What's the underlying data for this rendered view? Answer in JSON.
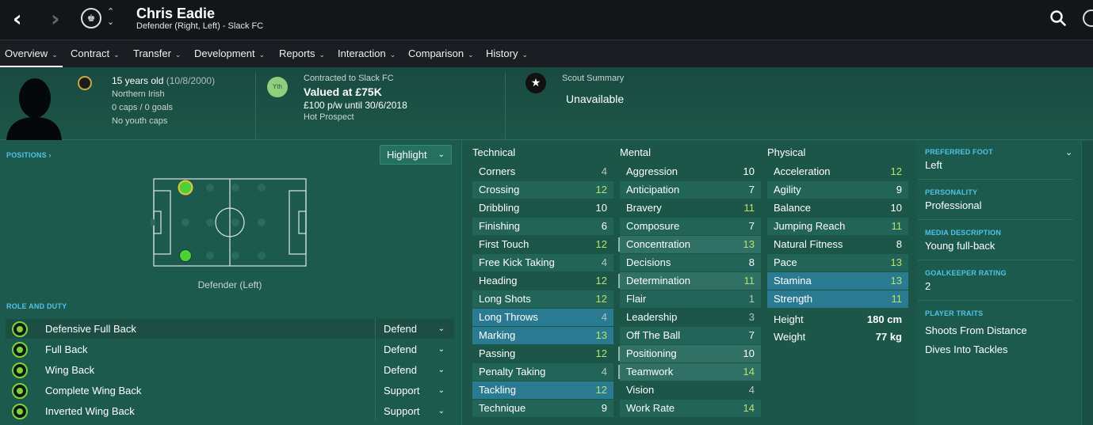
{
  "header": {
    "name": "Chris Eadie",
    "subtitle": "Defender (Right, Left) - Slack FC"
  },
  "tabs": [
    {
      "label": "Overview",
      "active": true
    },
    {
      "label": "Contract"
    },
    {
      "label": "Transfer"
    },
    {
      "label": "Development"
    },
    {
      "label": "Reports"
    },
    {
      "label": "Interaction"
    },
    {
      "label": "Comparison"
    },
    {
      "label": "History"
    }
  ],
  "info": {
    "age": "15 years old",
    "dob": "(10/8/2000)",
    "nationality": "Northern Irish",
    "caps": "0 caps / 0 goals",
    "youth_caps": "No youth caps",
    "yth_badge": "Yth",
    "contract": "Contracted to Slack FC",
    "value": "Valued at £75K",
    "wage": "£100 p/w until 30/6/2018",
    "status": "Hot Prospect",
    "scout_title": "Scout Summary",
    "scout_value": "Unavailable"
  },
  "positions": {
    "link": "POSITIONS",
    "highlight": "Highlight",
    "caption": "Defender (Left)"
  },
  "roles": {
    "title": "ROLE AND DUTY",
    "items": [
      {
        "name": "Defensive Full Back",
        "duty": "Defend"
      },
      {
        "name": "Full Back",
        "duty": "Defend"
      },
      {
        "name": "Wing Back",
        "duty": "Defend"
      },
      {
        "name": "Complete Wing Back",
        "duty": "Support"
      },
      {
        "name": "Inverted Wing Back",
        "duty": "Support"
      }
    ]
  },
  "attributes": {
    "technical_title": "Technical",
    "mental_title": "Mental",
    "physical_title": "Physical",
    "technical": [
      {
        "name": "Corners",
        "value": "4"
      },
      {
        "name": "Crossing",
        "value": "12"
      },
      {
        "name": "Dribbling",
        "value": "10"
      },
      {
        "name": "Finishing",
        "value": "6"
      },
      {
        "name": "First Touch",
        "value": "12"
      },
      {
        "name": "Free Kick Taking",
        "value": "4"
      },
      {
        "name": "Heading",
        "value": "12"
      },
      {
        "name": "Long Shots",
        "value": "12"
      },
      {
        "name": "Long Throws",
        "value": "4"
      },
      {
        "name": "Marking",
        "value": "13"
      },
      {
        "name": "Passing",
        "value": "12"
      },
      {
        "name": "Penalty Taking",
        "value": "4"
      },
      {
        "name": "Tackling",
        "value": "12"
      },
      {
        "name": "Technique",
        "value": "9"
      }
    ],
    "mental": [
      {
        "name": "Aggression",
        "value": "10"
      },
      {
        "name": "Anticipation",
        "value": "7"
      },
      {
        "name": "Bravery",
        "value": "11"
      },
      {
        "name": "Composure",
        "value": "7"
      },
      {
        "name": "Concentration",
        "value": "13"
      },
      {
        "name": "Decisions",
        "value": "8"
      },
      {
        "name": "Determination",
        "value": "11"
      },
      {
        "name": "Flair",
        "value": "1"
      },
      {
        "name": "Leadership",
        "value": "3"
      },
      {
        "name": "Off The Ball",
        "value": "7"
      },
      {
        "name": "Positioning",
        "value": "10"
      },
      {
        "name": "Teamwork",
        "value": "14"
      },
      {
        "name": "Vision",
        "value": "4"
      },
      {
        "name": "Work Rate",
        "value": "14"
      }
    ],
    "physical": [
      {
        "name": "Acceleration",
        "value": "12"
      },
      {
        "name": "Agility",
        "value": "9"
      },
      {
        "name": "Balance",
        "value": "10"
      },
      {
        "name": "Jumping Reach",
        "value": "11"
      },
      {
        "name": "Natural Fitness",
        "value": "8"
      },
      {
        "name": "Pace",
        "value": "13"
      },
      {
        "name": "Stamina",
        "value": "13"
      },
      {
        "name": "Strength",
        "value": "11"
      }
    ],
    "height_label": "Height",
    "height": "180 cm",
    "weight_label": "Weight",
    "weight": "77 kg"
  },
  "profile": {
    "foot_label": "PREFERRED FOOT",
    "foot": "Left",
    "personality_label": "PERSONALITY",
    "personality": "Professional",
    "media_label": "MEDIA DESCRIPTION",
    "media": "Young full-back",
    "gk_label": "GOALKEEPER RATING",
    "gk": "2",
    "traits_label": "PLAYER TRAITS",
    "traits": [
      "Shoots From Distance",
      "Dives Into Tackles"
    ]
  },
  "colors": {
    "accent": "#4fc3e8",
    "good_value": "#b8e26a",
    "position_green": "#4cd137"
  }
}
